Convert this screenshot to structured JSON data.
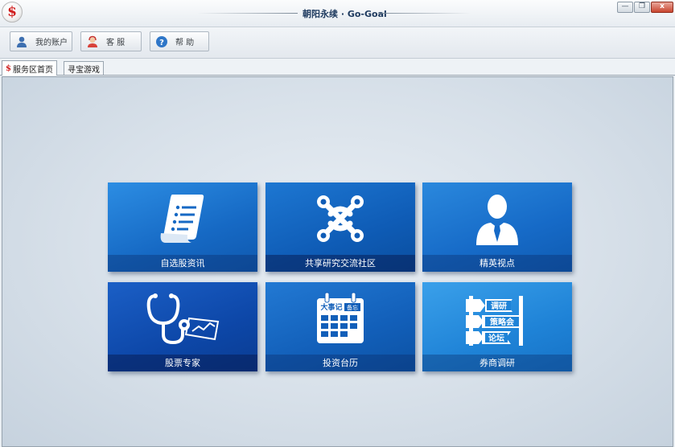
{
  "window": {
    "title": "朝阳永续 · Go-Goal",
    "logo_glyph": "$"
  },
  "window_buttons": [
    "—",
    "❐",
    "x"
  ],
  "toolbar": {
    "buttons": [
      {
        "label": "我的账户",
        "icon": "user-icon"
      },
      {
        "label": "客  服",
        "icon": "customer-service-icon"
      },
      {
        "label": "帮  助",
        "icon": "help-icon"
      }
    ]
  },
  "tabs": [
    {
      "label": "服务区首页",
      "active": true
    },
    {
      "label": "寻宝游戏",
      "active": false
    }
  ],
  "tiles": [
    {
      "label": "自选股资讯",
      "icon": "document-list-icon",
      "color": "#1669c4"
    },
    {
      "label": "共享研究交流社区",
      "icon": "community-knot-icon",
      "color": "#0f5cb6"
    },
    {
      "label": "精英视点",
      "icon": "business-person-icon",
      "color": "#166ac7"
    },
    {
      "label": "股票专家",
      "icon": "stethoscope-chart-icon",
      "color": "#0d47a8"
    },
    {
      "label": "投资台历",
      "icon": "calendar-icon",
      "color": "#125fb9"
    },
    {
      "label": "券商调研",
      "icon": "signpost-icon",
      "color": "#1f83d7"
    }
  ],
  "tile_icon_text": {
    "calendar_title": "大事记",
    "calendar_badge": "备忘",
    "signpost_1": "调研",
    "signpost_2": "策略会",
    "signpost_3": "论坛"
  }
}
